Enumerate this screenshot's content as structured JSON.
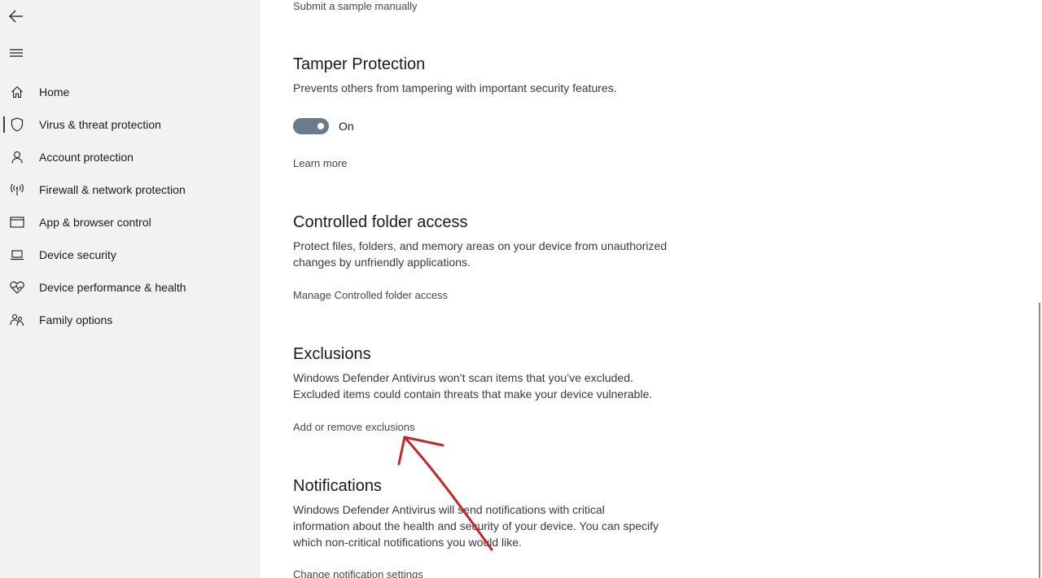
{
  "sidebar": {
    "items": [
      {
        "label": "Home",
        "icon": "home-icon"
      },
      {
        "label": "Virus & threat protection",
        "icon": "shield-icon",
        "active": true
      },
      {
        "label": "Account protection",
        "icon": "person-icon"
      },
      {
        "label": "Firewall & network protection",
        "icon": "antenna-icon"
      },
      {
        "label": "App & browser control",
        "icon": "browser-window-icon"
      },
      {
        "label": "Device security",
        "icon": "laptop-icon"
      },
      {
        "label": "Device performance & health",
        "icon": "heart-icon"
      },
      {
        "label": "Family options",
        "icon": "family-icon"
      }
    ]
  },
  "main": {
    "top_link": "Submit a sample manually",
    "tamper": {
      "title": "Tamper Protection",
      "description": "Prevents others from tampering with important security features.",
      "toggle_state": "On",
      "toggle_on": true,
      "link": "Learn more"
    },
    "cfa": {
      "title": "Controlled folder access",
      "description_line1": "Protect files, folders, and memory areas on your device from unauthorized",
      "description_line2": "changes by unfriendly applications.",
      "link": "Manage Controlled folder access"
    },
    "exclusions": {
      "title": "Exclusions",
      "description_line1": "Windows Defender Antivirus won’t scan items that you’ve excluded.",
      "description_line2": "Excluded items could contain threats that make your device vulnerable.",
      "link": "Add or remove exclusions"
    },
    "notifications": {
      "title": "Notifications",
      "description_line1": "Windows Defender Antivirus will send notifications with critical",
      "description_line2": "information about the health and security of your device. You can specify",
      "description_line3": "which non-critical notifications you would like.",
      "link": "Change notification settings"
    }
  },
  "colors": {
    "sidebar_bg": "#f2f2f2",
    "toggle_bg": "#6b7b8a",
    "annotation_arrow": "#c0282e"
  }
}
